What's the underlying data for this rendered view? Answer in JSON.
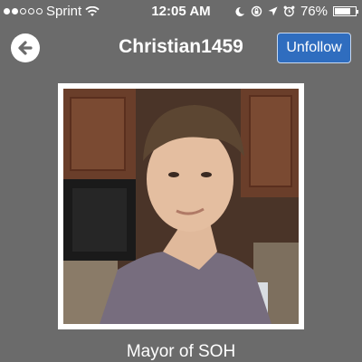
{
  "status_bar": {
    "carrier": "Sprint",
    "time": "12:05 AM",
    "battery": "76%",
    "battery_level": 0.76,
    "signal_bars_filled": 2,
    "signal_bars_total": 5,
    "icons": [
      "wifi-icon",
      "moon-icon",
      "rotation-lock-icon",
      "location-arrow-icon",
      "alarm-icon"
    ]
  },
  "nav": {
    "back_icon": "arrow-left-icon",
    "title": "Christian1459",
    "unfollow_label": "Unfollow"
  },
  "profile": {
    "photo": "profile-photo",
    "caption": "Mayor of SOH"
  },
  "colors": {
    "background": "#6b6b6b",
    "button": "#2f6dbf"
  }
}
